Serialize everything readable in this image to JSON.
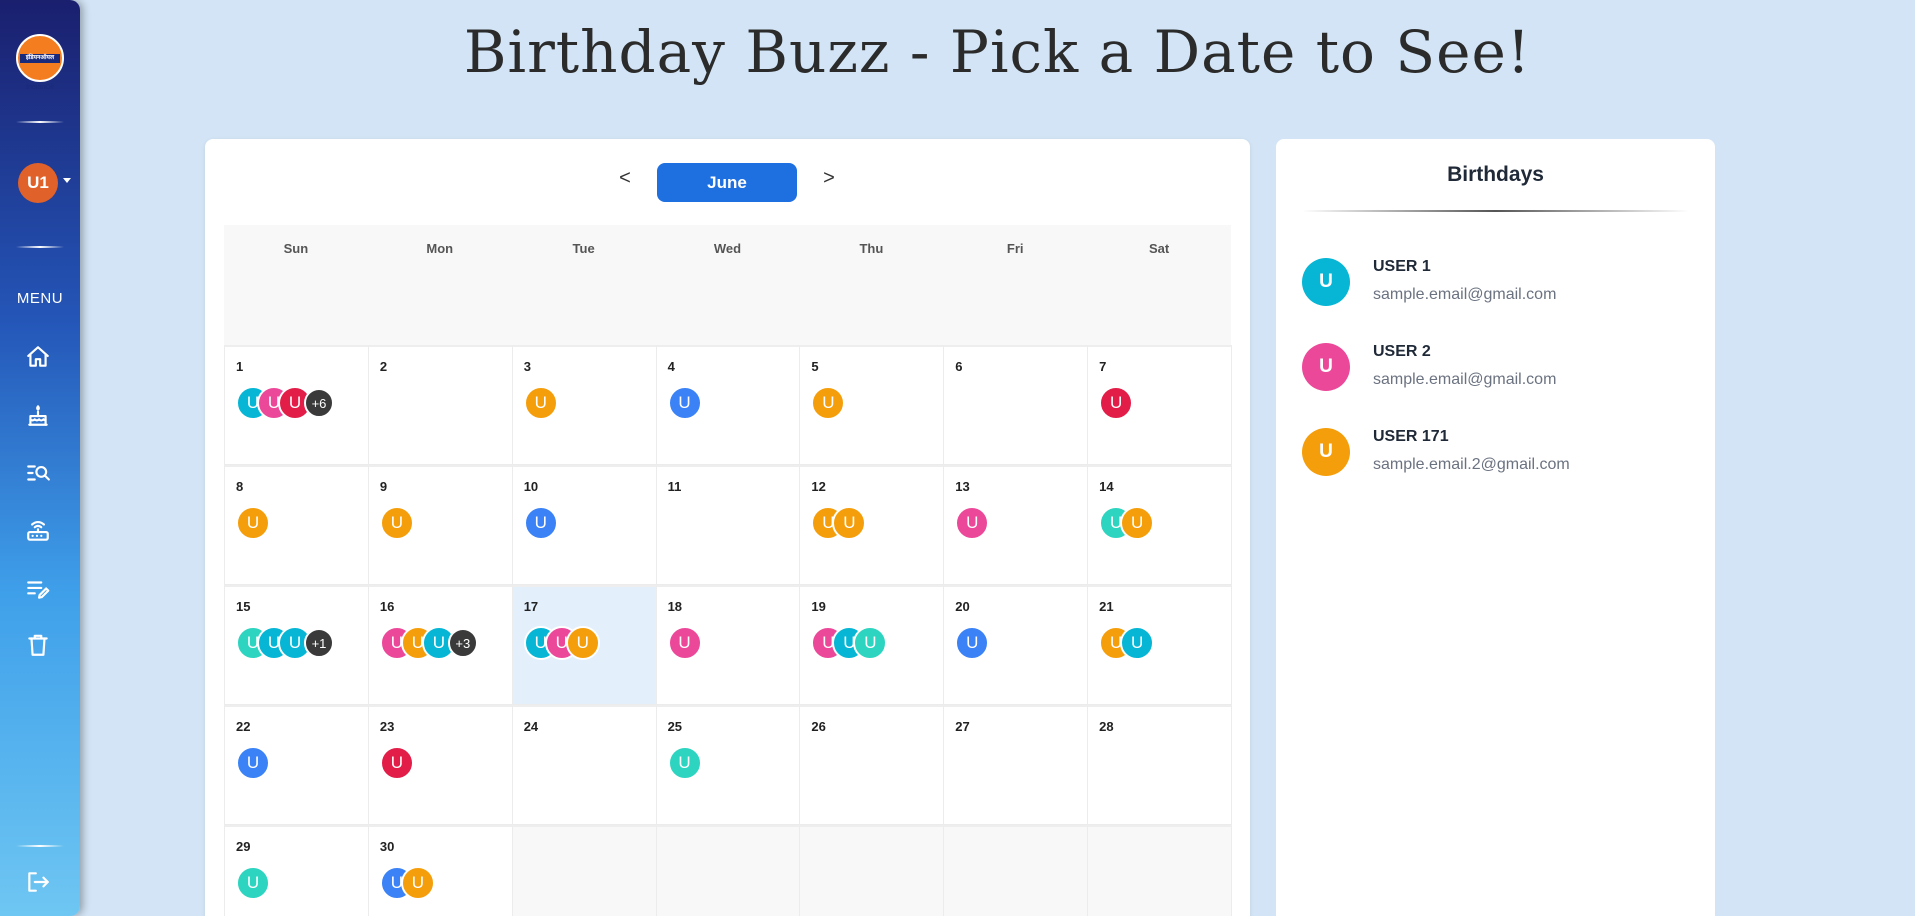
{
  "sidebar": {
    "logo_text": "इंडियनऑयल",
    "logo_caption": "IndianOil",
    "user_avatar": "U1",
    "menu_label": "MENU",
    "icons": [
      "home-icon",
      "birthday-cake-icon",
      "search-list-icon",
      "router-icon",
      "edit-list-icon",
      "trash-icon",
      "logout-icon"
    ]
  },
  "page_title": "Birthday Buzz - Pick a Date to See!",
  "calendar": {
    "prev_label": "<",
    "next_label": ">",
    "month": "June",
    "weekdays": [
      "Sun",
      "Mon",
      "Tue",
      "Wed",
      "Thu",
      "Fri",
      "Sat"
    ],
    "selected_day": 17,
    "days": [
      {
        "day": "1",
        "avatars": [
          {
            "letter": "U",
            "color": "#06b6d4"
          },
          {
            "letter": "U",
            "color": "#ec4899"
          },
          {
            "letter": "U",
            "color": "#e11d48"
          }
        ],
        "more": "+6"
      },
      {
        "day": "2",
        "avatars": []
      },
      {
        "day": "3",
        "avatars": [
          {
            "letter": "U",
            "color": "#f59e0b"
          }
        ]
      },
      {
        "day": "4",
        "avatars": [
          {
            "letter": "U",
            "color": "#3b82f6"
          }
        ]
      },
      {
        "day": "5",
        "avatars": [
          {
            "letter": "U",
            "color": "#f59e0b"
          }
        ]
      },
      {
        "day": "6",
        "avatars": []
      },
      {
        "day": "7",
        "avatars": [
          {
            "letter": "U",
            "color": "#e11d48"
          }
        ]
      },
      {
        "day": "8",
        "avatars": [
          {
            "letter": "U",
            "color": "#f59e0b"
          }
        ]
      },
      {
        "day": "9",
        "avatars": [
          {
            "letter": "U",
            "color": "#f59e0b"
          }
        ]
      },
      {
        "day": "10",
        "avatars": [
          {
            "letter": "U",
            "color": "#3b82f6"
          }
        ]
      },
      {
        "day": "11",
        "avatars": []
      },
      {
        "day": "12",
        "avatars": [
          {
            "letter": "U",
            "color": "#f59e0b"
          },
          {
            "letter": "U",
            "color": "#f59e0b"
          }
        ]
      },
      {
        "day": "13",
        "avatars": [
          {
            "letter": "U",
            "color": "#ec4899"
          }
        ]
      },
      {
        "day": "14",
        "avatars": [
          {
            "letter": "U",
            "color": "#2dd4bf"
          },
          {
            "letter": "U",
            "color": "#f59e0b"
          }
        ]
      },
      {
        "day": "15",
        "avatars": [
          {
            "letter": "U",
            "color": "#2dd4bf"
          },
          {
            "letter": "U",
            "color": "#06b6d4"
          },
          {
            "letter": "U",
            "color": "#06b6d4"
          }
        ],
        "more": "+1"
      },
      {
        "day": "16",
        "avatars": [
          {
            "letter": "U",
            "color": "#ec4899"
          },
          {
            "letter": "U",
            "color": "#f59e0b"
          },
          {
            "letter": "U",
            "color": "#06b6d4"
          }
        ],
        "more": "+3"
      },
      {
        "day": "17",
        "avatars": [
          {
            "letter": "U",
            "color": "#06b6d4"
          },
          {
            "letter": "U",
            "color": "#ec4899"
          },
          {
            "letter": "U",
            "color": "#f59e0b"
          }
        ]
      },
      {
        "day": "18",
        "avatars": [
          {
            "letter": "U",
            "color": "#ec4899"
          }
        ]
      },
      {
        "day": "19",
        "avatars": [
          {
            "letter": "U",
            "color": "#ec4899"
          },
          {
            "letter": "U",
            "color": "#06b6d4"
          },
          {
            "letter": "U",
            "color": "#2dd4bf"
          }
        ]
      },
      {
        "day": "20",
        "avatars": [
          {
            "letter": "U",
            "color": "#3b82f6"
          }
        ]
      },
      {
        "day": "21",
        "avatars": [
          {
            "letter": "U",
            "color": "#f59e0b"
          },
          {
            "letter": "U",
            "color": "#06b6d4"
          }
        ]
      },
      {
        "day": "22",
        "avatars": [
          {
            "letter": "U",
            "color": "#3b82f6"
          }
        ]
      },
      {
        "day": "23",
        "avatars": [
          {
            "letter": "U",
            "color": "#e11d48"
          }
        ]
      },
      {
        "day": "24",
        "avatars": []
      },
      {
        "day": "25",
        "avatars": [
          {
            "letter": "U",
            "color": "#2dd4bf"
          }
        ]
      },
      {
        "day": "26",
        "avatars": []
      },
      {
        "day": "27",
        "avatars": []
      },
      {
        "day": "28",
        "avatars": []
      },
      {
        "day": "29",
        "avatars": [
          {
            "letter": "U",
            "color": "#2dd4bf"
          }
        ]
      },
      {
        "day": "30",
        "avatars": [
          {
            "letter": "U",
            "color": "#3b82f6"
          },
          {
            "letter": "U",
            "color": "#f59e0b"
          }
        ]
      }
    ],
    "trailing_empty_cells": 5
  },
  "birthdays": {
    "title": "Birthdays",
    "items": [
      {
        "initial": "U",
        "name": "USER 1",
        "email": "sample.email@gmail.com",
        "color": "#06b6d4"
      },
      {
        "initial": "U",
        "name": "USER 2",
        "email": "sample.email@gmail.com",
        "color": "#ec4899"
      },
      {
        "initial": "U",
        "name": "USER 171",
        "email": "sample.email.2@gmail.com",
        "color": "#f59e0b"
      }
    ]
  }
}
